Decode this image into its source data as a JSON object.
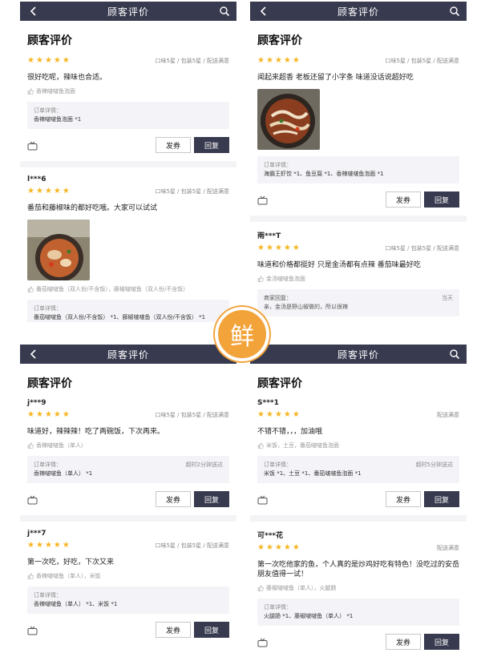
{
  "header": {
    "title": "顾客评价"
  },
  "section_title": "顾客评价",
  "badge_text": "鲜",
  "colors": {
    "navbar": "#383a4f",
    "star": "#f6b51f",
    "badge": "#f2a33a"
  },
  "labels": {
    "order_label": "订单详情：",
    "coupon_button": "发券",
    "reply_button": "回复",
    "merchant_reply_label": "商家回复："
  },
  "panel0": {
    "reviews": [
      {
        "user": "",
        "scores": "口味5星 / 包装5星 / 配送满意",
        "comment": "很好吃呢，辣味也合适。",
        "dishes": "香辣啵啵鱼泡面",
        "order_items": "香辣啵啵鱼泡面 *1"
      },
      {
        "user": "l***6",
        "scores": "口味5星 / 包装5星 / 配送满意",
        "comment": "番茄和藤椒味的都好吃哦。大家可以试试",
        "dishes": "番茄啵啵鱼（双人份/不含饭），藤椒啵啵鱼（双人份/不含饭）",
        "order_items": "番茄啵啵鱼（双人份/不含饭） *1、藤椒啵啵鱼（双人份/不含饭） *1"
      }
    ]
  },
  "panel1": {
    "reviews": [
      {
        "scores": "口味5星 / 包装5星 / 配送满意",
        "comment": "闻起来超香  老板还留了小字条  味道没话说超好吃",
        "order_items": "海霸王虾饺 *1、鱼豆腐 *1、香辣啵啵鱼泡面 *1"
      },
      {
        "user": "雨***T",
        "scores": "口味5星 / 包装5星 / 配送满意",
        "comment": "味道和价格都挺好  只是金汤都有点辣  番茄味最好吃",
        "dishes": "金汤啵啵鱼泡面",
        "reply_text": "亲，金汤是野山椒做的，所以很辣",
        "reply_time": "当天"
      }
    ]
  },
  "panel2": {
    "reviews": [
      {
        "user": "j***9",
        "scores": "口味5星 / 包装5星 / 配送满意",
        "comment": "味道好，辣辣辣！吃了两碗饭，下次再来。",
        "dishes": "香辣啵啵鱼（单人）",
        "delivery": "超时2分钟送达",
        "order_items": "香辣啵啵鱼（单人） *1"
      },
      {
        "user": "j***7",
        "scores": "口味5星 / 包装5星 / 配送满意",
        "comment": "第一次吃，好吃，下次又来",
        "dishes": "香辣啵啵鱼（单人），米饭",
        "order_items": "香辣啵啵鱼（单人） *1、米饭 *1"
      }
    ]
  },
  "panel3": {
    "reviews": [
      {
        "user": "S***1",
        "scores": "配送满意",
        "comment": "不错不错，，，加油哦",
        "dishes": "米饭，土豆，番茄啵啵鱼泡面",
        "delivery": "超时5分钟送达",
        "order_items": "米饭 *1、土豆 *1、番茄啵啵鱼泡面 *1"
      },
      {
        "user": "可***花",
        "scores": "配送满意",
        "comment": "第一次吃他家的鱼，个人真的是炒鸡好吃有特色！没吃过的安岳朋友值得一试！",
        "dishes": "藤椒啵啵鱼（单人），火腿肠",
        "order_items": "火腿肠 *1、藤椒啵啵鱼（单人） *1"
      }
    ]
  }
}
